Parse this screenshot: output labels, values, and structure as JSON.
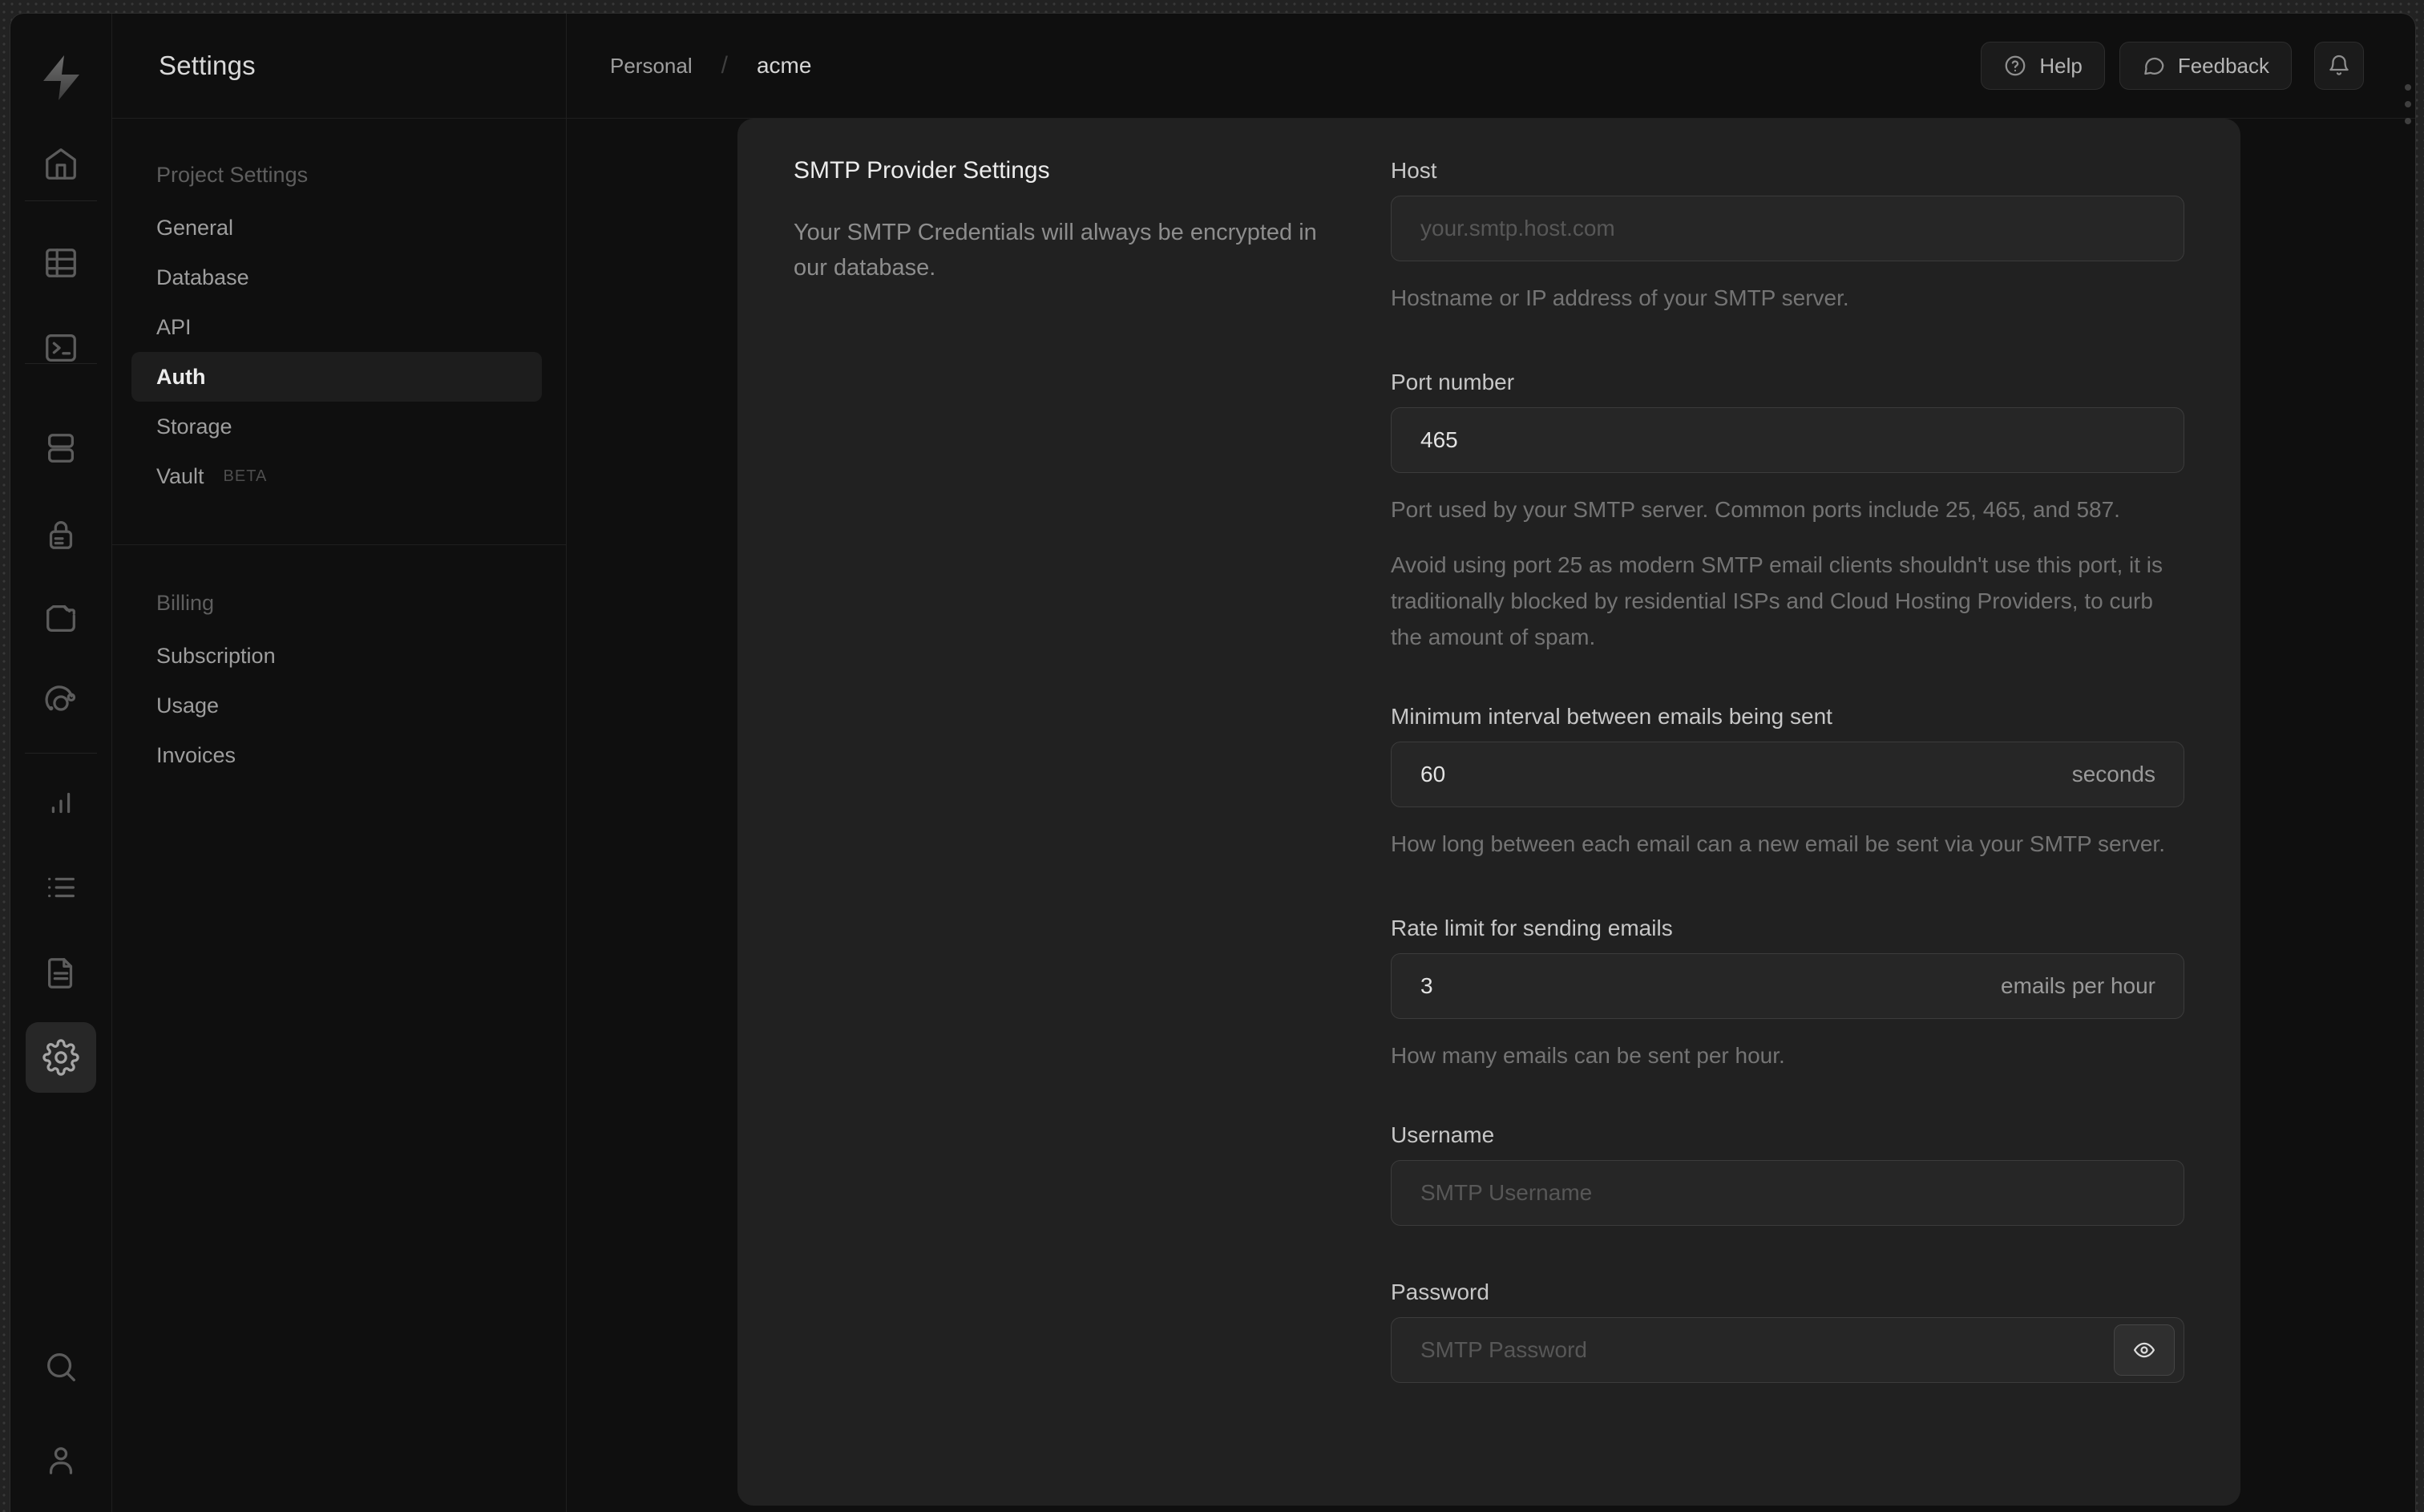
{
  "sidebar": {
    "title": "Settings",
    "sections": [
      {
        "label": "Project Settings",
        "items": [
          {
            "label": "General"
          },
          {
            "label": "Database"
          },
          {
            "label": "API"
          },
          {
            "label": "Auth",
            "active": true
          },
          {
            "label": "Storage"
          },
          {
            "label": "Vault",
            "badge": "BETA"
          }
        ]
      },
      {
        "label": "Billing",
        "items": [
          {
            "label": "Subscription"
          },
          {
            "label": "Usage"
          },
          {
            "label": "Invoices"
          }
        ]
      }
    ]
  },
  "topbar": {
    "breadcrumb": {
      "org": "Personal",
      "separator": "/",
      "project": "acme"
    },
    "help_label": "Help",
    "feedback_label": "Feedback"
  },
  "panel": {
    "heading": "SMTP Provider Settings",
    "description": "Your SMTP Credentials will always be encrypted in our database.",
    "fields": {
      "host": {
        "label": "Host",
        "placeholder": "your.smtp.host.com",
        "helper": "Hostname or IP address of your SMTP server."
      },
      "port": {
        "label": "Port number",
        "value": "465",
        "helper": "Port used by your SMTP server. Common ports include 25, 465, and 587.",
        "helper2": "Avoid using port 25 as modern SMTP email clients shouldn't use this port, it is traditionally blocked by residential ISPs and Cloud Hosting Providers, to curb the amount of spam."
      },
      "interval": {
        "label": "Minimum interval between emails being sent",
        "value": "60",
        "suffix": "seconds",
        "helper": "How long between each email can a new email be sent via your SMTP server."
      },
      "rate": {
        "label": "Rate limit for sending emails",
        "value": "3",
        "suffix": "emails per hour",
        "helper": "How many emails can be sent per hour."
      },
      "username": {
        "label": "Username",
        "placeholder": "SMTP Username"
      },
      "password": {
        "label": "Password",
        "placeholder": "SMTP Password"
      }
    }
  },
  "colors": {
    "window_bg": "#0f0f0f",
    "panel_bg": "#212121",
    "input_bg": "#262626",
    "divider": "#1f1f1f",
    "active_item_bg": "#1d1d1d"
  }
}
